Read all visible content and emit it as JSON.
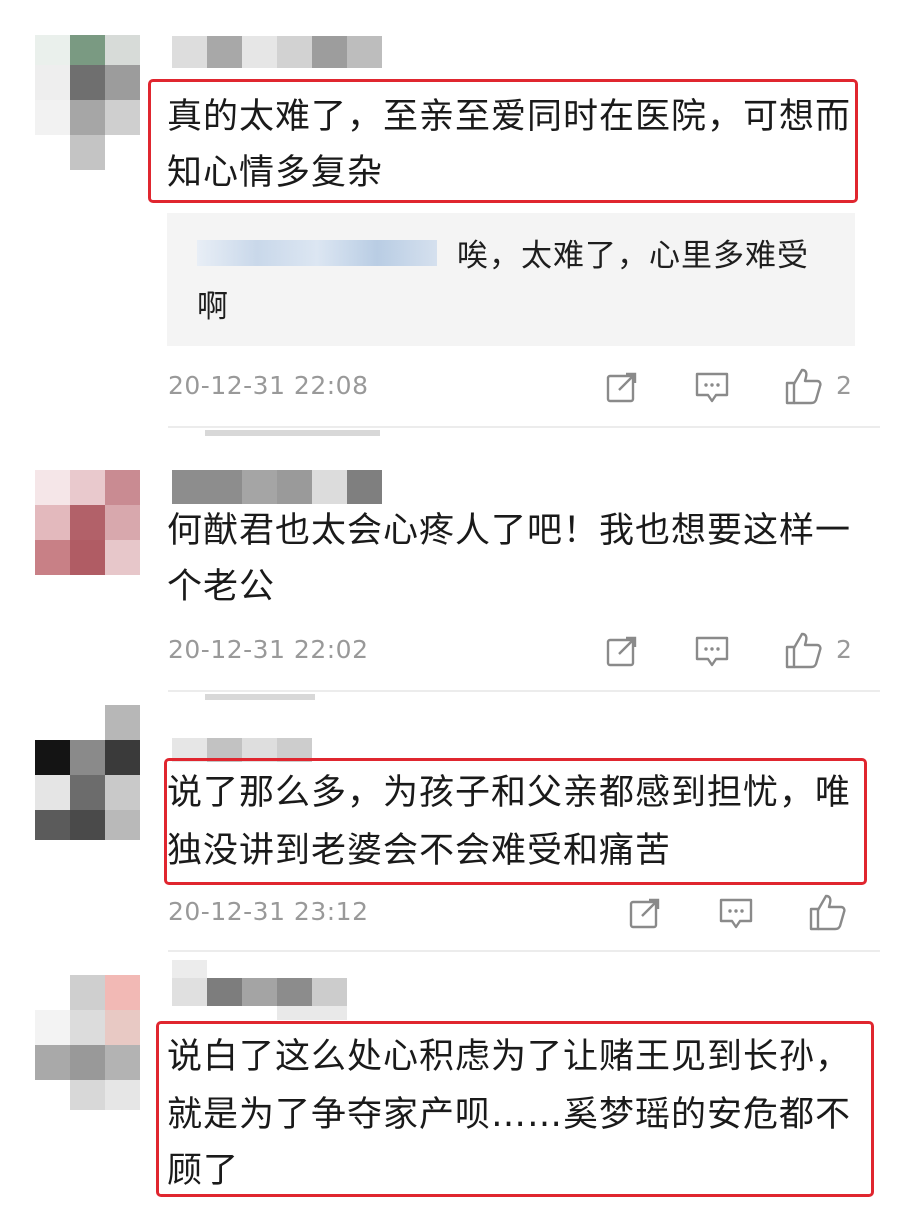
{
  "comments": [
    {
      "text_line1": "真的太难了，至亲至爱同时在医院，可想而",
      "text_line2": "知心情多复杂",
      "reply_line1": "唉，太难了，心里多难受",
      "reply_line2": "啊",
      "timestamp": "20-12-31 22:08",
      "likes": "2"
    },
    {
      "text_line1": "何猷君也太会心疼人了吧！我也想要这样一",
      "text_line2": "个老公",
      "timestamp": "20-12-31 22:02",
      "likes": "2"
    },
    {
      "text_line1": "说了那么多，为孩子和父亲都感到担忧，唯",
      "text_line2": "独没讲到老婆会不会难受和痛苦",
      "timestamp": "20-12-31 23:12",
      "likes": ""
    },
    {
      "text_line1": "说白了这么处心积虑为了让赌王见到长孙，",
      "text_line2": "就是为了争夺家产呗……奚梦瑶的安危都不",
      "text_line3": "顾了"
    }
  ],
  "colors": {
    "highlight": "#e0262f",
    "meta": "#999999",
    "reply_bg": "#f4f4f4"
  },
  "icons": [
    "share-icon",
    "comment-icon",
    "thumbs-up-icon"
  ]
}
